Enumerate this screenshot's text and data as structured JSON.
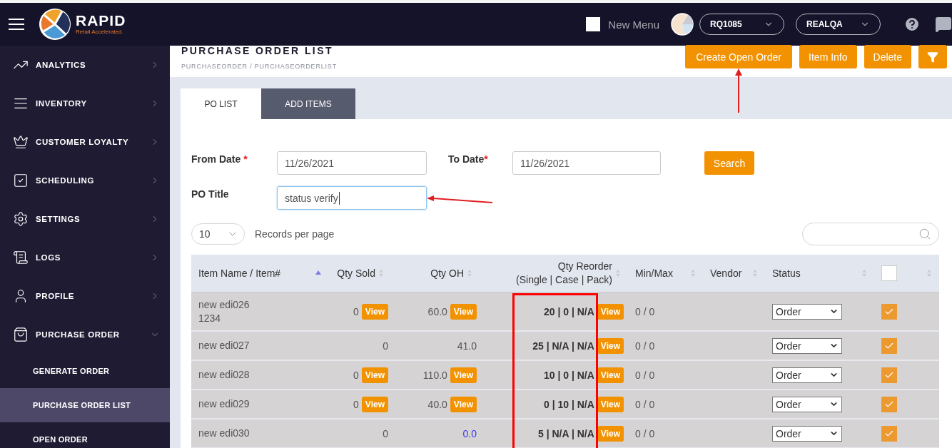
{
  "header": {
    "logo": {
      "name": "RAPID",
      "tagline": "Retail Accelerated."
    },
    "new_menu": {
      "label": "New Menu",
      "checked": false
    },
    "store_select": "RQ1085",
    "user_select": "REALQA"
  },
  "sidebar": {
    "items": [
      {
        "label": "ANALYTICS",
        "expanded": false,
        "selected": false
      },
      {
        "label": "INVENTORY",
        "expanded": false,
        "selected": false
      },
      {
        "label": "CUSTOMER LOYALTY",
        "expanded": false,
        "selected": false
      },
      {
        "label": "SCHEDULING",
        "expanded": false,
        "selected": false
      },
      {
        "label": "SETTINGS",
        "expanded": false,
        "selected": false
      },
      {
        "label": "LOGS",
        "expanded": false,
        "selected": false
      },
      {
        "label": "PROFILE",
        "expanded": false,
        "selected": false
      },
      {
        "label": "PURCHASE ORDER",
        "expanded": true,
        "selected": false,
        "children": [
          {
            "label": "GENERATE ORDER",
            "selected": false
          },
          {
            "label": "PURCHASE ORDER LIST",
            "selected": true
          },
          {
            "label": "OPEN ORDER",
            "selected": false
          }
        ]
      }
    ]
  },
  "page": {
    "title": "PURCHASE ORDER LIST",
    "breadcrumb": "PURCHASEORDER / PURCHASEORDERLIST",
    "actions": [
      {
        "kind": "text",
        "label": "Create Open Order",
        "pointed_at": true
      },
      {
        "kind": "text",
        "label": "Item Info"
      },
      {
        "kind": "text",
        "label": "Delete"
      },
      {
        "kind": "filter"
      }
    ]
  },
  "tabs": [
    {
      "label": "PO LIST",
      "selected": true
    },
    {
      "label": "ADD ITEMS",
      "selected": false
    }
  ],
  "form": {
    "from_date": {
      "label": "From Date",
      "required_mark": "*",
      "value": "11/26/2021"
    },
    "to_date": {
      "label": "To Date",
      "required_mark": "*",
      "value": "11/26/2021"
    },
    "search_button": "Search",
    "po_title": {
      "label": "PO Title",
      "value": "status verify",
      "pointed_at": true
    }
  },
  "pager": {
    "page_size": "10",
    "label": "Records per page"
  },
  "table": {
    "columns": [
      {
        "label": "Item Name / Item#",
        "sorted": true
      },
      {
        "label": "Qty Sold",
        "sorted": false
      },
      {
        "label": "Qty OH",
        "sorted": false
      },
      {
        "label": "Qty Reorder",
        "sublabel": "(Single | Case | Pack)",
        "sorted": false,
        "highlighted": true
      },
      {
        "label": "Min/Max",
        "sorted": false
      },
      {
        "label": "Vendor",
        "sorted": false
      },
      {
        "label": "Status",
        "sorted": false
      },
      {
        "kind": "checkbox",
        "checked": false,
        "sorted": false
      }
    ],
    "rows": [
      {
        "name": "new edi026",
        "item_no": "1234",
        "qty_sold": "0",
        "sold_view": "View",
        "qty_oh": "60.0",
        "oh_view": "View",
        "qty_oh_link": false,
        "reorder": "20 | 0 | N/A",
        "reorder_view": "View",
        "min_max": "0 / 0",
        "status": "Order",
        "checked": true
      },
      {
        "name": "new edi027",
        "qty_sold": "0",
        "qty_oh": "41.0",
        "qty_oh_link": false,
        "reorder": "25 | N/A | N/A",
        "reorder_view": "View",
        "min_max": "0 / 0",
        "status": "Order",
        "checked": true
      },
      {
        "name": "new edi028",
        "qty_sold": "0",
        "sold_view": "View",
        "qty_oh": "110.0",
        "oh_view": "View",
        "qty_oh_link": false,
        "reorder": "10 | 0 | N/A",
        "reorder_view": "View",
        "min_max": "0 / 0",
        "status": "Order",
        "checked": true
      },
      {
        "name": "new edi029",
        "qty_sold": "0",
        "sold_view": "View",
        "qty_oh": "40.0",
        "oh_view": "View",
        "qty_oh_link": false,
        "reorder": "0 | 10 | N/A",
        "reorder_view": "View",
        "min_max": "0 / 0",
        "status": "Order",
        "checked": true
      },
      {
        "name": "new edi030",
        "qty_sold": "0",
        "qty_oh": "0.0",
        "qty_oh_link": true,
        "reorder": "5 | N/A | N/A",
        "reorder_view": "View",
        "min_max": "0 / 0",
        "status": "Order",
        "checked": true
      }
    ]
  }
}
